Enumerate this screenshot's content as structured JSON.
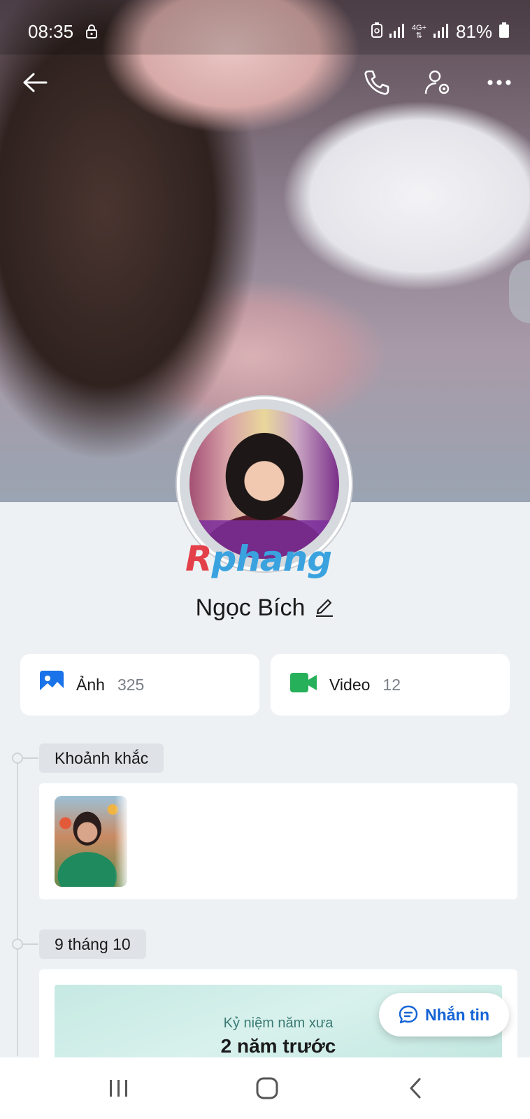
{
  "status_bar": {
    "time": "08:35",
    "network_label_top": "4G+",
    "battery_percent": "81%"
  },
  "profile": {
    "name": "Ngọc Bích",
    "watermark": "Rphang"
  },
  "media": {
    "photos_label": "Ảnh",
    "photos_count": "325",
    "videos_label": "Video",
    "videos_count": "12"
  },
  "timeline": {
    "section1_label": "Khoảnh khắc",
    "section2_label": "9 tháng 10",
    "memory_subtitle": "Kỷ niệm năm xưa",
    "memory_title": "2 năm trước"
  },
  "fab": {
    "label": "Nhắn tin"
  },
  "colors": {
    "accent_blue": "#1463d6",
    "video_green": "#27b05a",
    "photo_blue": "#1a73e8"
  }
}
